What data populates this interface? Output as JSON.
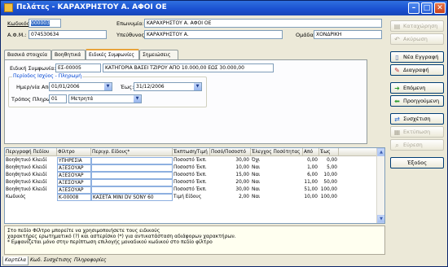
{
  "window": {
    "title": "Πελάτες - ΚΑΡΑΧΡΗΣΤΟΥ Α. ΑΦΟΙ ΟΕ"
  },
  "header": {
    "code_label": "Κωδικός:",
    "code_value": "000003",
    "name_label": "Επωνυμία:",
    "name_value": "ΚΑΡΑΧΡΗΣΤΟΥ Α. ΑΦΟΙ ΟΕ",
    "afm_label": "Α.Φ.Μ.:",
    "afm_value": "074530634",
    "resp_label": "Υπεύθυνος:",
    "resp_value": "ΚΑΡΑΧΡΗΣΤΟΥ Α.",
    "group_label": "Ομάδα:",
    "group_value": "ΧΟΝΔΡΙΚΗ"
  },
  "tabs": [
    "Βασικά στοιχεία",
    "Βοηθητικά",
    "Ειδικές Συμφωνίες",
    "Σημειώσεις"
  ],
  "agreement": {
    "code_label": "Ειδική Συμφωνία:",
    "code_value": "ΕΣ-00005",
    "desc_value": "ΚΑΤΗΓΟΡΙΑ ΒΑΣΕΙ ΤΖΙΡΟΥ ΑΠΟ 10.000,00 ΕΩΣ 30.000,00",
    "period_group": "Περίοδος Ισχύος - Πληρωμή",
    "from_label": "Ημερ/νία Από:",
    "from_value": "01/01/2006",
    "to_label": "Έως:",
    "to_value": "31/12/2006",
    "payment_label": "Τρόπος Πληρωμής:",
    "payment_code": "01",
    "payment_value": "Μετρητά"
  },
  "grid": {
    "headers": [
      "Περιγραφή Πεδίου",
      "Φίλτρο",
      "Περιγρ. Είδους*",
      "Έκπτωση/Τιμή",
      "Ποσό/Ποσοστό",
      "Έλεγχος Ποσότητας",
      "Από",
      "Έως"
    ],
    "rows": [
      [
        "Βοηθητικό Κλειδί",
        "ΥΠΗΡΕΣΙΑ",
        "",
        "Ποσοστό Έκπ.",
        "30,00",
        "Όχι",
        "0,00",
        "0,00"
      ],
      [
        "Βοηθητικό Κλειδί",
        "ΑΞΕΣΟΥΑΡ",
        "",
        "Ποσοστό Έκπ.",
        "10,00",
        "Ναι",
        "1,00",
        "5,00"
      ],
      [
        "Βοηθητικό Κλειδί",
        "ΑΞΕΣΟΥΑΡ",
        "",
        "Ποσοστό Έκπ.",
        "15,00",
        "Ναι",
        "6,00",
        "10,00"
      ],
      [
        "Βοηθητικό Κλειδί",
        "ΑΞΕΣΟΥΑΡ",
        "",
        "Ποσοστό Έκπ.",
        "20,00",
        "Ναι",
        "11,00",
        "50,00"
      ],
      [
        "Βοηθητικό Κλειδί",
        "ΑΞΕΣΟΥΑΡ",
        "",
        "Ποσοστό Έκπ.",
        "30,00",
        "Ναι",
        "51,00",
        "100,00"
      ],
      [
        "Κωδικός",
        "Κ-00008",
        "ΚΑΣΕΤΑ MINI DV SONY 60",
        "Τιμή Είδους",
        "2,00",
        "Ναι",
        "10,00",
        "100,00"
      ]
    ]
  },
  "note": {
    "line1": "Στο πεδίο Φίλτρο μπορείτε να χρησιμοποιήσετε τους ειδικούς",
    "line2": "χαρακτήρες ερωτηματικό (?) και αστερίσκο (*) για αντικατάσταση αδιάφορων χαρακτήρων.",
    "line3": "* Εμφανίζεται μόνο στην περίπτωση επιλογής μοναδικού κωδικού στο πεδίο φίλτρο"
  },
  "bottom_tabs": [
    "Καρτέλα",
    "Κωδ. Συσχέτισης",
    "Πληροφορίες"
  ],
  "buttons": {
    "save": "Καταχώρηση",
    "cancel": "Ακύρωση",
    "new": "Νέα Εγγραφή",
    "delete": "Διαγραφή",
    "next": "Επόμενη",
    "previous": "Προηγούμενη",
    "related": "Συσχέτιση",
    "print": "Εκτύπωση",
    "search": "Εύρεση",
    "exit": "Έξοδος"
  },
  "colors": {
    "titlebar": "#1a4fd0",
    "selection": "#316ac5",
    "group_title": "#0046d5"
  }
}
